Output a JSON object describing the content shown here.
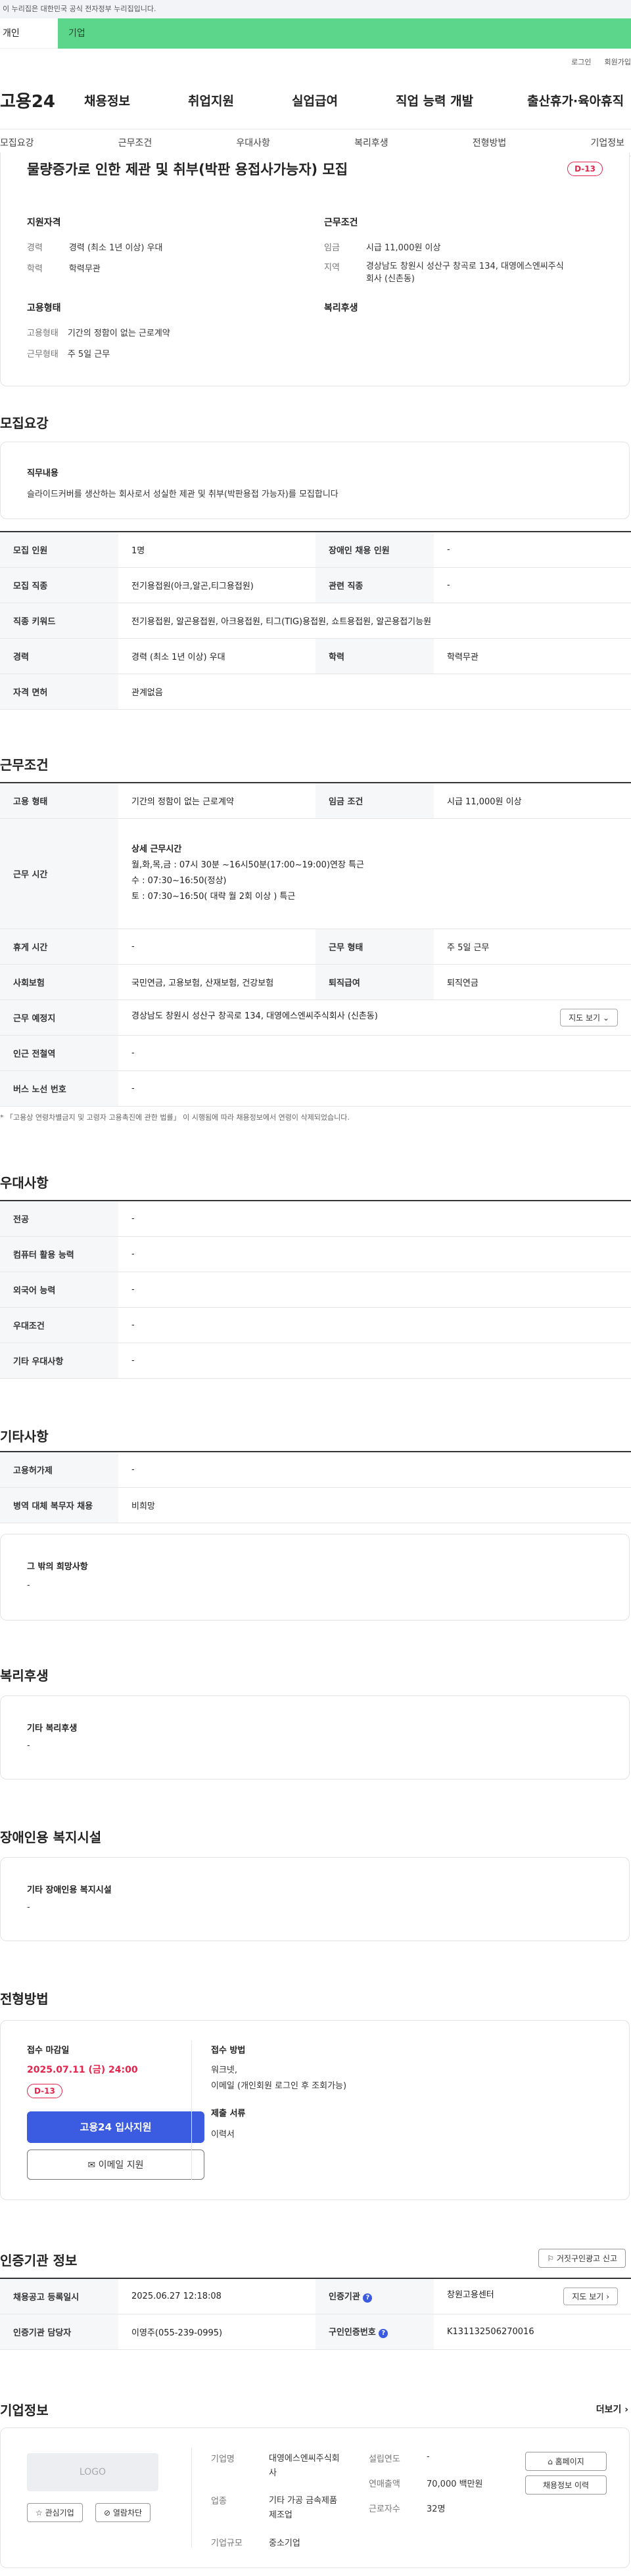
{
  "notice": "이 누리집은 대한민국 공식 전자정부 누리집입니다.",
  "audience_tabs": {
    "person": "개인",
    "company": "기업"
  },
  "util": {
    "login": "로그인",
    "join": "회원가입"
  },
  "logo": "고용24",
  "gnb": [
    "채용정보",
    "취업지원",
    "실업급여",
    "직업 능력 개발",
    "출산휴가·육아휴직"
  ],
  "subnav": [
    "모집요강",
    "근무조건",
    "우대사항",
    "복리후생",
    "전형방법",
    "기업정보"
  ],
  "summary": {
    "title": "물량증가로 인한 제관 및 취부(박판 용접사가능자) 모집",
    "dday": "D-13",
    "qual_title": "지원자격",
    "career_label": "경력",
    "career_value": "경력 (최소 1년 이상) 우대",
    "edu_label": "학력",
    "edu_value": "학력무관",
    "cond_title": "근무조건",
    "wage_label": "임금",
    "wage_value": "시급 11,000원 이상",
    "region_label": "지역",
    "region_value": "경상남도 창원시 성산구 창곡로 134, 대영에스엔씨주식회사 (신촌동)",
    "emp_title": "고용형태",
    "emp_label": "고용형태",
    "emp_value": "기간의 정함이 없는 근로계약",
    "work_label": "근무형태",
    "work_value": "주 5일 근무",
    "welfare_title": "복리후생"
  },
  "recruit": {
    "section": "모집요강",
    "duty_title": "직무내용",
    "duty_text": "슬라이드커버를 생산하는 회사로서 성실한 제관 및 취부(박판용접 가능자)를 모집합니다",
    "headcount_label": "모집 인원",
    "headcount_value": "1명",
    "disabled_label": "장애인 채용 인원",
    "disabled_value": "-",
    "job_label": "모집 직종",
    "job_value": "전기용접원(아크,알곤,티그용접원)",
    "related_label": "관련 직종",
    "related_value": "-",
    "keyword_label": "직종 키워드",
    "keyword_value": "전기용접원, 알곤용접원, 아크용접원, 티그(TIG)용접원, 쇼트용접원, 알곤용접기능원",
    "career_label": "경력",
    "career_value": "경력 (최소 1년 이상) 우대",
    "edu_label": "학력",
    "edu_value": "학력무관",
    "license_label": "자격 면허",
    "license_value": "관계없음"
  },
  "conditions": {
    "section": "근무조건",
    "emp_label": "고용 형태",
    "emp_value": "기간의 정함이 없는 근로계약",
    "wage_label": "임금 조건",
    "wage_value": "시급 11,000원 이상",
    "time_label": "근무 시간",
    "time_title": "상세 근무시간",
    "time_line1": "월,화,목,금 : 07시 30분 ~16시50분(17:00~19:00)연장 특근",
    "time_line2": "수 : 07:30~16:50(정상)",
    "time_line3": "토 : 07:30~16:50( 대략 월 2회 이상 ) 특근",
    "holiday_label": "휴게 시간",
    "holiday_value": "-",
    "worktype_label": "근무 형태",
    "worktype_value": "주 5일 근무",
    "insurance_label": "사회보험",
    "insurance_value": "국민연금, 고용보험, 산재보험, 건강보험",
    "retire_label": "퇴직급여",
    "retire_value": "퇴직연금",
    "place_label": "근무 예정지",
    "place_value": "경상남도 창원시 성산구 창곡로 134, 대영에스엔씨주식회사 (신촌동)",
    "map_btn": "지도 보기",
    "subway_label": "인근 전철역",
    "subway_value": "-",
    "bus_label": "버스 노선 번호",
    "bus_value": "-",
    "note": "* 「고용상 연령차별금지 및 고령자 고용촉진에 관한 법률」 이 시행됨에 따라 채용정보에서 연령이 삭제되었습니다."
  },
  "preference": {
    "section": "우대사항",
    "rows": [
      {
        "label": "전공",
        "value": "-"
      },
      {
        "label": "컴퓨터 활용 능력",
        "value": "-"
      },
      {
        "label": "외국어 능력",
        "value": "-"
      },
      {
        "label": "우대조건",
        "value": "-"
      },
      {
        "label": "기타 우대사항",
        "value": "-"
      }
    ]
  },
  "etc": {
    "section": "기타사항",
    "rows": [
      {
        "label": "고용허가제",
        "value": "-"
      },
      {
        "label": "병역 대체 복무자 채용",
        "value": "비희망"
      }
    ],
    "wish_title": "그 밖의 희망사항",
    "wish_value": "-"
  },
  "welfare": {
    "section": "복리후생",
    "title": "기타 복리후생",
    "value": "-"
  },
  "facility": {
    "section": "장애인용 복지시설",
    "title": "기타 장애인용 복지시설",
    "value": "-"
  },
  "selection": {
    "section": "전형방법",
    "deadline_title": "접수 마감일",
    "deadline_value": "2025.07.11 (금) 24:00",
    "dday": "D-13",
    "apply_btn": "고용24 입사지원",
    "email_btn": "이메일 지원",
    "method_title": "접수 방법",
    "method_value1": "워크넷,",
    "method_value2": "이메일 (개인회원 로그인 후 조회가능)",
    "docs_title": "제출 서류",
    "docs_value": "이력서"
  },
  "agency": {
    "section": "인증기관 정보",
    "report_btn": "거짓구인광고 신고",
    "reg_label": "채용공고 등록일시",
    "reg_value": "2025.06.27 12:18:08",
    "org_label": "인증기관",
    "org_value": "창원고용센터",
    "map_btn": "지도 보기",
    "manager_label": "인증기관 담당자",
    "manager_value": "이영주(055-239-0995)",
    "num_label": "구인인증번호",
    "num_value": "K131132506270016"
  },
  "company": {
    "section": "기업정보",
    "more": "더보기",
    "logo": "LOGO",
    "fav_btn": "관심기업",
    "block_btn": "열람차단",
    "name_label": "기업명",
    "name_value": "대영에스엔씨주식회사",
    "industry_label": "업종",
    "industry_value": "기타 가공 금속제품 제조업",
    "scale_label": "기업규모",
    "scale_value": "중소기업",
    "year_label": "설립연도",
    "year_value": "-",
    "sales_label": "연매출액",
    "sales_value": "70,000 백만원",
    "staff_label": "근로자수",
    "staff_value": "32명",
    "home_btn": "홈페이지",
    "history_btn": "채용정보 이력"
  }
}
